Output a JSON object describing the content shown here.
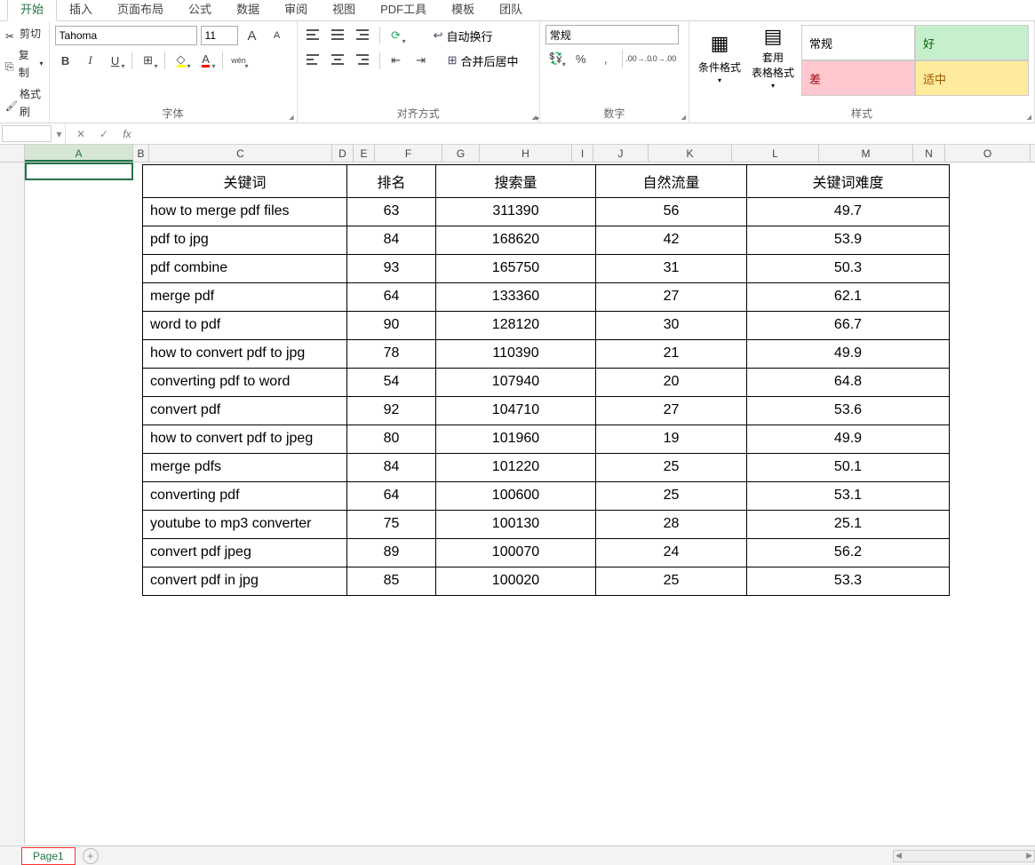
{
  "ribbon": {
    "tabs": [
      "开始",
      "插入",
      "页面布局",
      "公式",
      "数据",
      "审阅",
      "视图",
      "PDF工具",
      "模板",
      "团队"
    ],
    "clipboard": {
      "cut": "剪切",
      "copy": "复制",
      "brush": "格式刷"
    },
    "font": {
      "name": "Tahoma",
      "size": "11",
      "increase": "A",
      "decrease": "A",
      "bold": "B",
      "italic": "I",
      "underline": "U",
      "pinyin": "wén"
    },
    "group_font": "字体",
    "alignment": {
      "wrap": "自动换行",
      "merge": "合并后居中"
    },
    "group_align": "对齐方式",
    "number": {
      "format": "常规",
      "label": "数字"
    },
    "styles": {
      "cond": "条件格式",
      "table": "套用\n表格格式",
      "normal": "常规",
      "good": "好",
      "bad": "差",
      "neutral": "适中",
      "label": "样式"
    }
  },
  "name_box": "",
  "fx": "fx",
  "columns": [
    "A",
    "B",
    "C",
    "D",
    "E",
    "F",
    "G",
    "H",
    "I",
    "J",
    "K",
    "L",
    "M",
    "N",
    "O"
  ],
  "headers": {
    "keyword": "关键词",
    "rank": "排名",
    "volume": "搜索量",
    "traffic": "自然流量",
    "difficulty": "关键词难度"
  },
  "rows": [
    {
      "keyword": "how to merge pdf files",
      "rank": "63",
      "volume": "311390",
      "traffic": "56",
      "difficulty": "49.7",
      "tall": true
    },
    {
      "keyword": "pdf to jpg",
      "rank": "84",
      "volume": "168620",
      "traffic": "42",
      "difficulty": "53.9"
    },
    {
      "keyword": "pdf combine",
      "rank": "93",
      "volume": "165750",
      "traffic": "31",
      "difficulty": "50.3"
    },
    {
      "keyword": "merge pdf",
      "rank": "64",
      "volume": "133360",
      "traffic": "27",
      "difficulty": "62.1"
    },
    {
      "keyword": "word to pdf",
      "rank": "90",
      "volume": "128120",
      "traffic": "30",
      "difficulty": "66.7"
    },
    {
      "keyword": "how to convert pdf to jpg",
      "rank": "78",
      "volume": "110390",
      "traffic": "21",
      "difficulty": "49.9",
      "tall": true
    },
    {
      "keyword": "converting pdf to word",
      "rank": "54",
      "volume": "107940",
      "traffic": "20",
      "difficulty": "64.8",
      "tall": true
    },
    {
      "keyword": "convert pdf",
      "rank": "92",
      "volume": "104710",
      "traffic": "27",
      "difficulty": "53.6"
    },
    {
      "keyword": "how to convert pdf to jpeg",
      "rank": "80",
      "volume": "101960",
      "traffic": "19",
      "difficulty": "49.9",
      "tall": true
    },
    {
      "keyword": "merge pdfs",
      "rank": "84",
      "volume": "101220",
      "traffic": "25",
      "difficulty": "50.1"
    },
    {
      "keyword": "converting pdf",
      "rank": "64",
      "volume": "100600",
      "traffic": "25",
      "difficulty": "53.1"
    },
    {
      "keyword": "youtube to mp3 converter",
      "rank": "75",
      "volume": "100130",
      "traffic": "28",
      "difficulty": "25.1",
      "tall": true
    },
    {
      "keyword": "convert pdf jpeg",
      "rank": "89",
      "volume": "100070",
      "traffic": "24",
      "difficulty": "56.2"
    },
    {
      "keyword": "convert pdf in jpg",
      "rank": "85",
      "volume": "100020",
      "traffic": "25",
      "difficulty": "53.3"
    }
  ],
  "sheet": {
    "name": "Page1",
    "add": "+"
  }
}
